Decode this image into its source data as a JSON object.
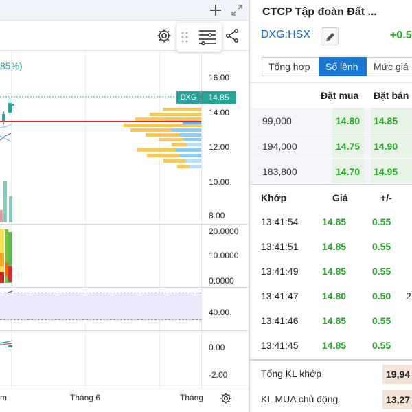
{
  "chart": {
    "pct_change_label": "85%)",
    "price_axis": [
      "16.00",
      "14.00",
      "12.00",
      "10.00",
      "8.00"
    ],
    "volume_axis": [
      "20.0000",
      "10.0000",
      "0.0000"
    ],
    "rsi_axis": [
      "40.00"
    ],
    "macd_axis": [
      "0.00",
      "-2.00"
    ],
    "time_axis": [
      "m",
      "Tháng 6",
      "Tháng"
    ],
    "price_tag": {
      "symbol": "DXG",
      "value": "14.85"
    },
    "colors": {
      "up": "#26a69a",
      "down": "#ef5350",
      "poc_line": "#d32f2f",
      "vp_up": "#f6c85f",
      "vp_down": "#64b5f6"
    },
    "icons": {
      "add": "plus-icon",
      "expand": "expand-icon",
      "settings": "gear-icon",
      "drag": "drag-handle-icon",
      "tools": "indicator-lines-icon",
      "share": "share-icon",
      "time_settings": "gear-icon"
    }
  },
  "orderbook": {
    "company": "CTCP Tập đoàn Đất ...",
    "ticker": "DXG:HSX",
    "change": "+0.5",
    "tabs": [
      "Tổng hợp",
      "Số lệnh",
      "Mức giá"
    ],
    "active_tab": "Số lệnh",
    "depth_headers": {
      "buy": "Đặt mua",
      "sell": "Đặt bán"
    },
    "depth": [
      {
        "volume": "99,000",
        "bid": "14.80",
        "ask": "14.85"
      },
      {
        "volume": "194,000",
        "bid": "14.75",
        "ask": "14.90"
      },
      {
        "volume": "183,800",
        "bid": "14.70",
        "ask": "14.95"
      }
    ],
    "trade_headers": {
      "time": "Khớp",
      "price": "Giá",
      "change": "+/-"
    },
    "trades": [
      {
        "time": "13:41:54",
        "price": "14.85",
        "change": "0.55",
        "volume": ""
      },
      {
        "time": "13:41:51",
        "price": "14.85",
        "change": "0.55",
        "volume": ""
      },
      {
        "time": "13:41:49",
        "price": "14.85",
        "change": "0.55",
        "volume": ""
      },
      {
        "time": "13:41:47",
        "price": "14.80",
        "change": "0.50",
        "volume": "2"
      },
      {
        "time": "13:41:46",
        "price": "14.85",
        "change": "0.55",
        "volume": ""
      },
      {
        "time": "13:41:45",
        "price": "14.85",
        "change": "0.55",
        "volume": ""
      }
    ],
    "totals": {
      "matched_label": "Tổng KL khớp",
      "matched_value": "19,94",
      "active_buy_label": "KL MUA chủ động",
      "active_buy_value": "13,27"
    }
  }
}
